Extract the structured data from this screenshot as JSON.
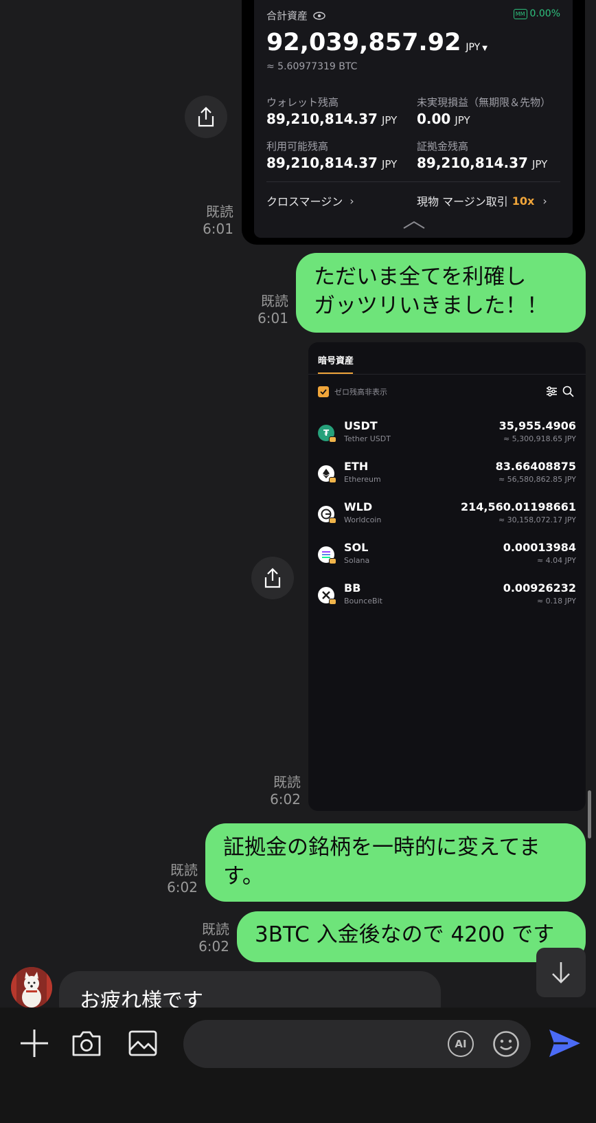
{
  "card1": {
    "title": "合計資産",
    "mm_badge": "MM",
    "mm_value": "0.00%",
    "total_value": "92,039,857.92",
    "total_unit": "JPY",
    "btc_equiv": "≈ 5.60977319 BTC",
    "wallet_label": "ウォレット残高",
    "wallet_value": "89,210,814.37",
    "unrealized_label": "未実現損益（無期限＆先物）",
    "unrealized_value": "0.00",
    "available_label": "利用可能残高",
    "available_value": "89,210,814.37",
    "margin_label": "証拠金残高",
    "margin_value": "89,210,814.37",
    "unit": "JPY",
    "cross_margin": "クロスマージン",
    "spot_margin": "現物 マージン取引",
    "leverage": "10x"
  },
  "messages": {
    "read": "既読",
    "msg1_time": "6:01",
    "msg2_time": "6:01",
    "msg2_line1": "ただいま全てを利確し",
    "msg2_line2": "ガッツリいきました！！",
    "msg3_time": "6:02",
    "msg4_time": "6:02",
    "msg4_line1": "証拠金の銘柄を一時的に変えてま",
    "msg4_line2": "す。",
    "msg5_time": "6:02",
    "msg5_text": "3BTC 入金後なので 4200 です",
    "incoming_text": "お疲れ様です"
  },
  "card2": {
    "tab": "暗号資産",
    "hide_zero": "ゼロ残高非表示",
    "assets": [
      {
        "symbol": "USDT",
        "name": "Tether USDT",
        "amount": "35,955.4906",
        "jpy": "≈ 5,300,918.65 JPY"
      },
      {
        "symbol": "ETH",
        "name": "Ethereum",
        "amount": "83.66408875",
        "jpy": "≈ 56,580,862.85 JPY"
      },
      {
        "symbol": "WLD",
        "name": "Worldcoin",
        "amount": "214,560.01198661",
        "jpy": "≈ 30,158,072.17 JPY"
      },
      {
        "symbol": "SOL",
        "name": "Solana",
        "amount": "0.00013984",
        "jpy": "≈ 4.04 JPY"
      },
      {
        "symbol": "BB",
        "name": "BounceBit",
        "amount": "0.00926232",
        "jpy": "≈ 0.18 JPY"
      }
    ]
  },
  "composer": {
    "ai_label": "AI"
  },
  "colors": {
    "bubble_green": "#6ee47a",
    "mm_green": "#2ec27e",
    "accent_orange": "#f0a53a",
    "send_blue": "#4b6bf5"
  }
}
